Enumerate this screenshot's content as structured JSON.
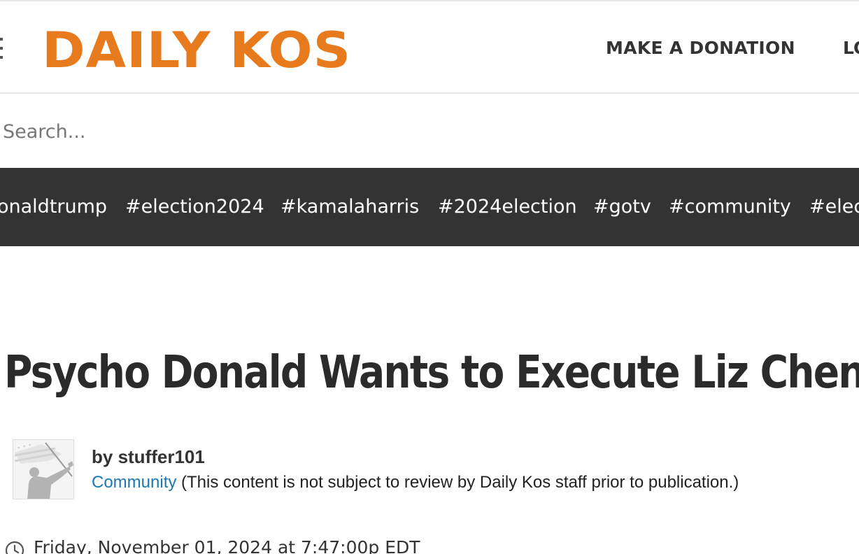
{
  "header": {
    "logo_text": "DAILY KOS",
    "logo_color": "#e87a1e",
    "nav": {
      "donate_label": "MAKE A DONATION",
      "login_label": "LO"
    }
  },
  "search": {
    "placeholder": "Search..."
  },
  "tags": [
    "onaldtrump",
    "#election2024",
    "#kamalaharris",
    "#2024election",
    "#gotv",
    "#community",
    "#elec"
  ],
  "article": {
    "title": "Psycho Donald Wants to Execute Liz Cheney",
    "byline": "by stuffer101",
    "community_link": "Community",
    "community_note": " (This content is not subject to review by Daily Kos staff prior to publication.)",
    "date": "Friday, November 01, 2024 at 7:47:00p EDT"
  },
  "colors": {
    "tagbar_bg": "#333333",
    "link": "#1a7ab3",
    "text": "#2b2b2b"
  }
}
